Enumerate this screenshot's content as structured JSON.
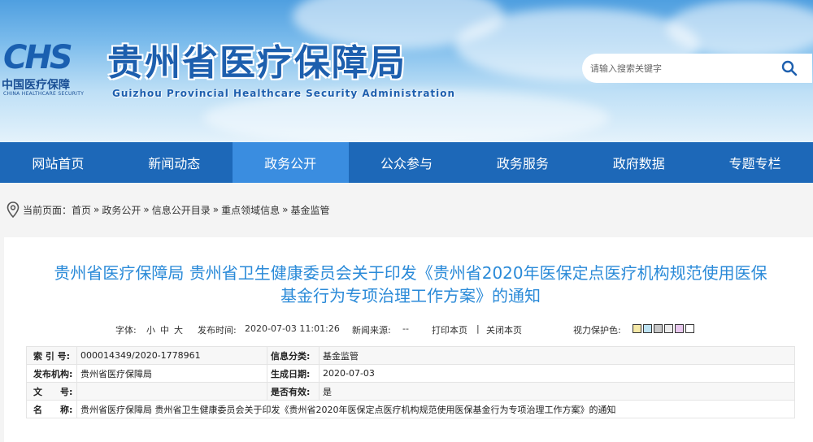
{
  "header": {
    "logo_mark": "CHS",
    "logo_cn": "中国医疗保障",
    "logo_en": "CHINA HEALTHCARE SECURITY",
    "title": "贵州省医疗保障局",
    "subtitle": "Guizhou Provincial Healthcare Security Administration",
    "search_placeholder": "请输入搜索关键字",
    "search_icon": "search-icon"
  },
  "nav": {
    "items": [
      {
        "label": "网站首页"
      },
      {
        "label": "新闻动态"
      },
      {
        "label": "政务公开"
      },
      {
        "label": "公众参与"
      },
      {
        "label": "政务服务"
      },
      {
        "label": "政府数据"
      },
      {
        "label": "专题专栏"
      }
    ],
    "active_index": 2
  },
  "breadcrumb": {
    "prefix": "当前页面：",
    "items": [
      "首页",
      "政务公开",
      "信息公开目录",
      "重点领域信息",
      "基金监管"
    ],
    "separator": "»"
  },
  "article": {
    "title_line1": "贵州省医疗保障局 贵州省卫生健康委员会关于印发《贵州省2020年医保定点医疗机构规范使用医保",
    "title_line2": "基金行为专项治理工作方案》的通知",
    "meta": {
      "font_label": "字体:",
      "font_small": "小",
      "font_mid": "中",
      "font_large": "大",
      "published_label": "发布时间:",
      "published": "2020-07-03 11:01:26",
      "source_label": "新闻来源:",
      "source": "--",
      "print": "打印本页",
      "divider": "|",
      "close": "关闭本页",
      "eye_label": "视力保护色:",
      "eye_colors": [
        "#f5e9a8",
        "#bde2f2",
        "#c8c8c8",
        "#ececec",
        "#e8c8ee",
        "#ffffff"
      ]
    },
    "info": {
      "index_label": "索 引 号:",
      "index": "000014349/2020-1778961",
      "category_label": "信息分类:",
      "category": "基金监管",
      "publisher_label": "发布机构:",
      "publisher": "贵州省医疗保障局",
      "date_label": "生成日期:",
      "date": "2020-07-03",
      "docno_label": "文　　号:",
      "docno": "",
      "valid_label": "是否有效:",
      "valid": "是",
      "name_label": "名　　称:",
      "name": "贵州省医疗保障局 贵州省卫生健康委员会关于印发《贵州省2020年医保定点医疗机构规范使用医保基金行为专项治理工作方案》的通知"
    }
  }
}
